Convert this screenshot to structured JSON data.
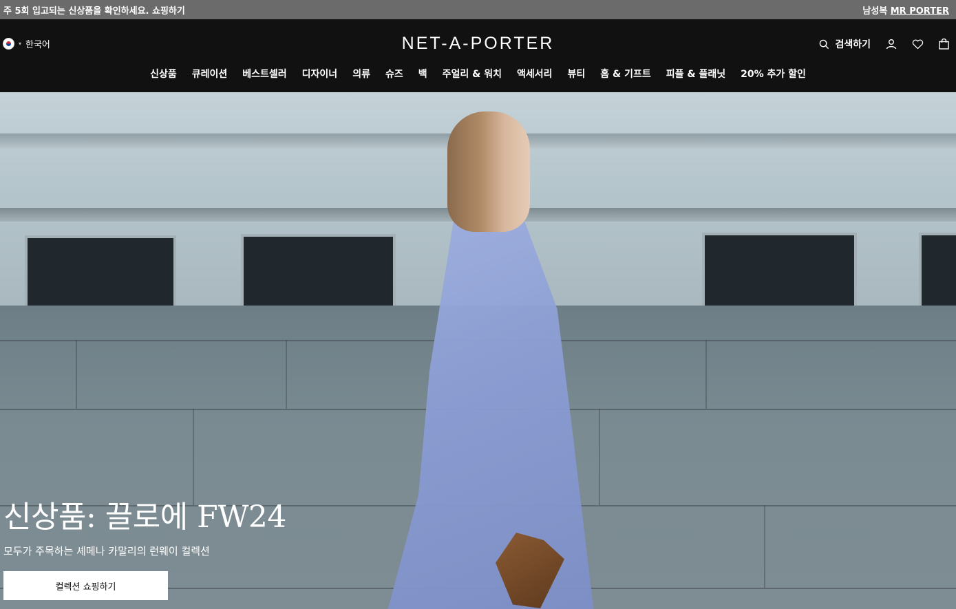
{
  "promo": {
    "left_text": "주 5회 입고되는 신상품을 확인하세요. 쇼핑하기",
    "right_prefix": "남성복",
    "right_link": "MR PORTER"
  },
  "header": {
    "language": "한국어",
    "logo": "NET-A-PORTER",
    "search_label": "검색하기"
  },
  "nav": [
    "신상품",
    "큐레이션",
    "베스트셀러",
    "디자이너",
    "의류",
    "슈즈",
    "백",
    "주얼리 & 워치",
    "액세서리",
    "뷰티",
    "홈 & 기프트",
    "피플 & 플래닛",
    "20% 추가 할인"
  ],
  "hero": {
    "title": "신상품: 끌로에 FW24",
    "subtitle": "모두가 주목하는 셰메나 카말리의 런웨이 컬렉션",
    "button_label": "컬렉션 쇼핑하기"
  }
}
